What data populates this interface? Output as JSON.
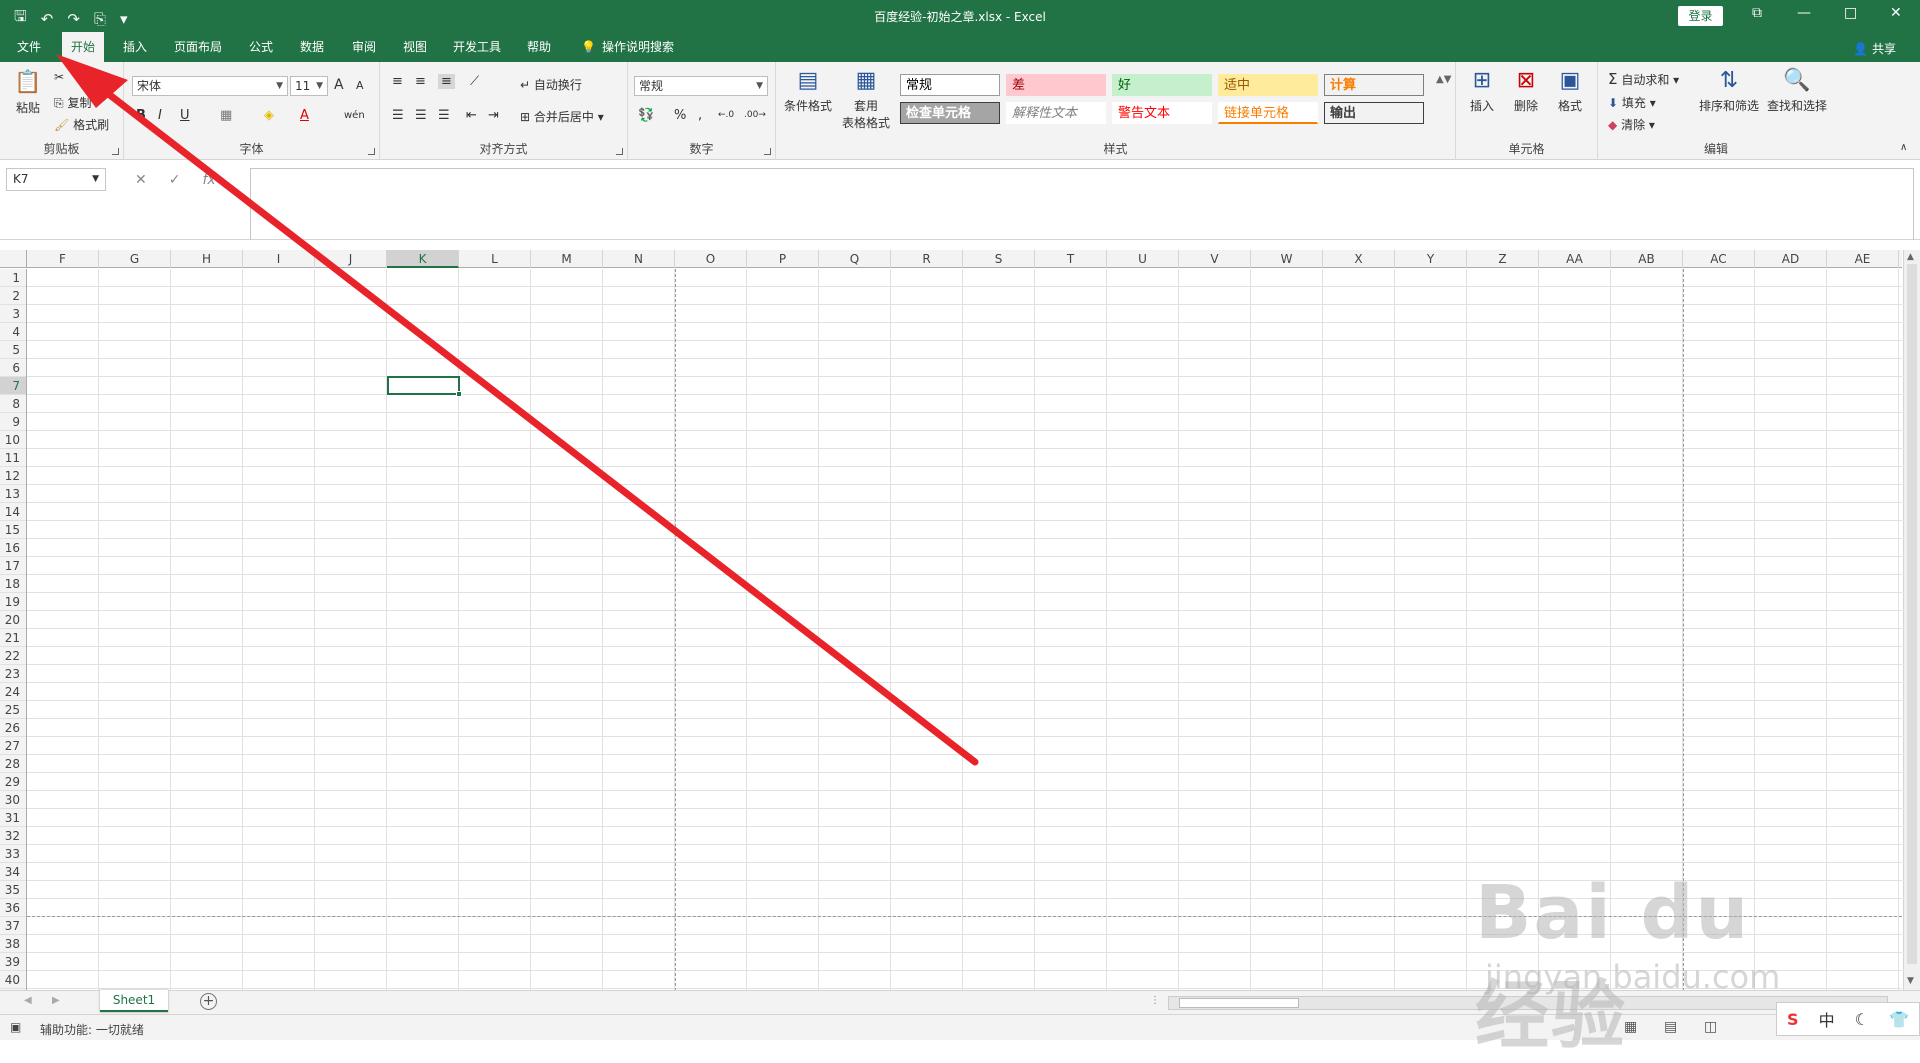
{
  "window": {
    "title": "百度经验-初始之章.xlsx  -  Excel",
    "login_label": "登录",
    "minimize": "—",
    "restore": "□",
    "close": "✕",
    "restore_ribbon": "⧉"
  },
  "qat": {
    "save": "🖫",
    "undo": "↶",
    "redo": "↷",
    "extra": "⎘",
    "customize": "▾"
  },
  "tabs": {
    "file": "文件",
    "home": "开始",
    "insert": "插入",
    "layout": "页面布局",
    "formulas": "公式",
    "data": "数据",
    "review": "审阅",
    "view": "视图",
    "developer": "开发工具",
    "help": "帮助",
    "tellme": "操作说明搜索",
    "share": "共享"
  },
  "ribbon": {
    "clipboard": {
      "label": "剪贴板",
      "paste": "粘贴",
      "cut": "✂",
      "copy": "复制",
      "format_painter": "格式刷"
    },
    "font": {
      "label": "字体",
      "name": "宋体",
      "size": "11",
      "bold": "B",
      "italic": "I",
      "underline": "U",
      "grow": "A",
      "shrink": "A",
      "wen": "wén"
    },
    "alignment": {
      "label": "对齐方式",
      "wrap": "自动换行",
      "merge": "合并后居中"
    },
    "number": {
      "label": "数字",
      "format": "常规",
      "percent": "%",
      "comma": ",",
      "inc": "←.0",
      "dec": ".00→"
    },
    "styles": {
      "label": "样式",
      "conditional": "条件格式",
      "as_table_1": "套用",
      "as_table_2": "表格格式",
      "cells": [
        {
          "text": "常规",
          "bg": "#ffffff",
          "fg": "#000000",
          "border": "#9b9b9b"
        },
        {
          "text": "差",
          "bg": "#ffc7ce",
          "fg": "#9c0006",
          "border": "#ffc7ce"
        },
        {
          "text": "好",
          "bg": "#c6efce",
          "fg": "#006100",
          "border": "#c6efce"
        },
        {
          "text": "适中",
          "bg": "#ffeb9c",
          "fg": "#9c5700",
          "border": "#ffeb9c"
        },
        {
          "text": "计算",
          "bg": "#f2f2f2",
          "fg": "#fa7d00",
          "border": "#7f7f7f"
        },
        {
          "text": "检查单元格",
          "bg": "#a5a5a5",
          "fg": "#ffffff",
          "border": "#3f3f3f"
        },
        {
          "text": "解释性文本",
          "bg": "#ffffff",
          "fg": "#7f7f7f",
          "border": "#ffffff"
        },
        {
          "text": "警告文本",
          "bg": "#ffffff",
          "fg": "#ff0000",
          "border": "#ffffff"
        },
        {
          "text": "链接单元格",
          "bg": "#ffffff",
          "fg": "#fa7d00",
          "border": "#ffffff"
        },
        {
          "text": "输出",
          "bg": "#f2f2f2",
          "fg": "#3f3f3f",
          "border": "#3f3f3f"
        }
      ]
    },
    "cells": {
      "label": "单元格",
      "insert": "插入",
      "delete": "删除",
      "format": "格式"
    },
    "editing": {
      "label": "编辑",
      "autosum": "自动求和",
      "fill": "填充",
      "clear": "清除",
      "sort": "排序和筛选",
      "find": "查找和选择"
    }
  },
  "formula_bar": {
    "namebox": "K7",
    "cancel": "✕",
    "enter": "✓",
    "fx": "fx",
    "value": ""
  },
  "sheet": {
    "columns": [
      "F",
      "G",
      "H",
      "I",
      "J",
      "K",
      "L",
      "M",
      "N",
      "O",
      "P",
      "Q",
      "R",
      "S",
      "T",
      "U",
      "V",
      "W",
      "X",
      "Y",
      "Z",
      "AA",
      "AB",
      "AC",
      "AD",
      "AE"
    ],
    "selected_column": "K",
    "rows": [
      "1",
      "2",
      "3",
      "4",
      "5",
      "6",
      "7",
      "8",
      "9",
      "10",
      "11",
      "12",
      "13",
      "14",
      "15",
      "16",
      "17",
      "18",
      "19",
      "20",
      "21",
      "22",
      "23",
      "24",
      "25",
      "26",
      "27",
      "28",
      "29",
      "30",
      "31",
      "32",
      "33",
      "34",
      "35",
      "36",
      "37",
      "38",
      "39",
      "40"
    ],
    "selected_row": "7",
    "selected_cell": "K7"
  },
  "sheet_tabs": {
    "tab1": "Sheet1",
    "add": "+"
  },
  "status": {
    "accessibility": "辅助功能: 一切就绪"
  },
  "ime": {
    "sogou": "S",
    "lang": "中",
    "moon": "☾",
    "shirt": "👕"
  },
  "watermark": {
    "brand": "Bai du 经验",
    "url": "jingyan.baidu.com"
  },
  "annotation_color": "#e8232a"
}
